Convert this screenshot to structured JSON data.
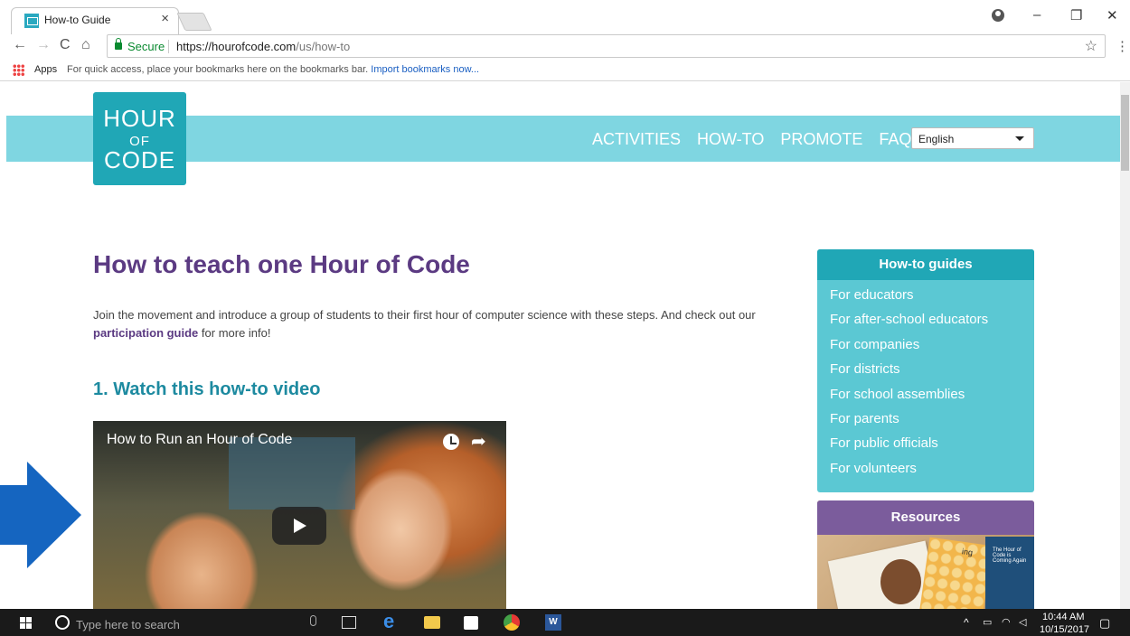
{
  "browser": {
    "tab_title": "How-to Guide",
    "tab_close": "×",
    "secure_label": "Secure",
    "url_base": "https://hourofcode.com",
    "url_path": "/us/how-to",
    "bookmarks": {
      "apps_label": "Apps",
      "hint": "For quick access, place your bookmarks here on the bookmarks bar.",
      "import_label": "Import bookmarks now..."
    }
  },
  "site": {
    "logo": {
      "line1": "HOUR",
      "line2": "OF",
      "line3": "CODE"
    },
    "nav": [
      {
        "label": "ACTIVITIES"
      },
      {
        "label": "HOW-TO"
      },
      {
        "label": "PROMOTE"
      },
      {
        "label": "FAQ"
      }
    ],
    "language": "English"
  },
  "content": {
    "title": "How to teach one Hour of Code",
    "intro_before": "Join the movement and introduce a group of students to their first hour of computer science with these steps. And check out our ",
    "intro_link": "participation guide",
    "intro_after": " for more info!",
    "step1_title": "1. Watch this how-to video",
    "video_title": "How to Run an Hour of Code"
  },
  "sidebar": {
    "guides_title": "How-to guides",
    "guides": [
      {
        "label": "For educators"
      },
      {
        "label": "For after-school educators"
      },
      {
        "label": "For companies"
      },
      {
        "label": "For districts"
      },
      {
        "label": "For school assemblies"
      },
      {
        "label": "For parents"
      },
      {
        "label": "For public officials"
      },
      {
        "label": "For volunteers"
      }
    ],
    "resources_title": "Resources",
    "resource_book_partial": "ing",
    "resource_book_blue": "The Hour of Code is Coming Again"
  },
  "taskbar": {
    "search_placeholder": "Type here to search",
    "time": "10:44 AM",
    "date": "10/15/2017"
  },
  "colors": {
    "header_band": "#7fd6e1",
    "logo_bg": "#20a7b6",
    "title_purple": "#5b3a82",
    "step_teal": "#1d8aa0",
    "guides_bg": "#5bc8d3",
    "resources_head": "#7b5c9c",
    "arrow_blue": "#1565c0"
  }
}
